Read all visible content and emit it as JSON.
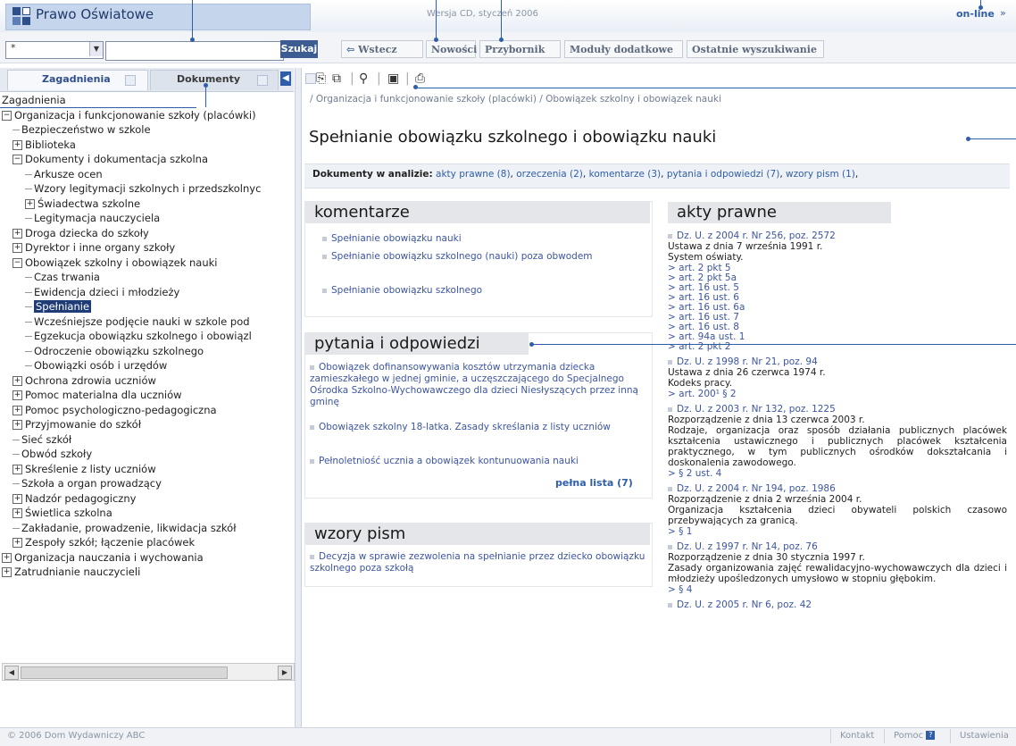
{
  "app": {
    "title": "Prawo Oświatowe",
    "version": "Wersja CD, styczeń 2006",
    "online": "on-line",
    "online_arrow": "»"
  },
  "toolbar": {
    "combo_value": "*",
    "search_placeholder": "",
    "search_label": "Szukaj",
    "back_label": "Wstecz",
    "buttons": [
      "Nowości",
      "Przybornik",
      "Moduły dodatkowe",
      "Ostatnie wyszukiwanie"
    ]
  },
  "left": {
    "tabs": [
      "Zagadnienia",
      "Dokumenty"
    ],
    "tree": [
      {
        "label": "Zagadnienia",
        "level": 0,
        "toggle": ""
      },
      {
        "label": "Organizacja i funkcjonowanie szkoły (placówki)",
        "level": 0,
        "toggle": "-"
      },
      {
        "label": "Bezpieczeństwo w szkole",
        "level": 1,
        "toggle": ""
      },
      {
        "label": "Biblioteka",
        "level": 1,
        "toggle": "+"
      },
      {
        "label": "Dokumenty i dokumentacja szkolna",
        "level": 1,
        "toggle": "-"
      },
      {
        "label": "Arkusze ocen",
        "level": 2,
        "toggle": ""
      },
      {
        "label": "Wzory legitymacji szkolnych i przedszkolnyc",
        "level": 2,
        "toggle": ""
      },
      {
        "label": "Świadectwa szkolne",
        "level": 2,
        "toggle": "+"
      },
      {
        "label": "Legitymacja nauczyciela",
        "level": 2,
        "toggle": ""
      },
      {
        "label": "Droga dziecka do szkoły",
        "level": 1,
        "toggle": "+"
      },
      {
        "label": "Dyrektor i inne organy szkoły",
        "level": 1,
        "toggle": "+"
      },
      {
        "label": "Obowiązek szkolny i obowiązek nauki",
        "level": 1,
        "toggle": "-"
      },
      {
        "label": "Czas trwania",
        "level": 2,
        "toggle": ""
      },
      {
        "label": "Ewidencja dzieci i młodzieży",
        "level": 2,
        "toggle": ""
      },
      {
        "label": "Spełnianie",
        "level": 2,
        "toggle": "",
        "selected": true
      },
      {
        "label": "Wcześniejsze podjęcie nauki w szkole pod",
        "level": 2,
        "toggle": ""
      },
      {
        "label": "Egzekucja obowiązku szkolnego i obowiązl",
        "level": 2,
        "toggle": ""
      },
      {
        "label": "Odroczenie obowiązku szkolnego",
        "level": 2,
        "toggle": ""
      },
      {
        "label": "Obowiązki osób i urzędów",
        "level": 2,
        "toggle": ""
      },
      {
        "label": "Ochrona zdrowia uczniów",
        "level": 1,
        "toggle": "+"
      },
      {
        "label": "Pomoc materialna dla uczniów",
        "level": 1,
        "toggle": "+"
      },
      {
        "label": "Pomoc psychologiczno-pedagogiczna",
        "level": 1,
        "toggle": "+"
      },
      {
        "label": "Przyjmowanie do szkół",
        "level": 1,
        "toggle": "+"
      },
      {
        "label": "Sieć szkół",
        "level": 1,
        "toggle": ""
      },
      {
        "label": "Obwód szkoły",
        "level": 1,
        "toggle": ""
      },
      {
        "label": "Skreślenie z listy uczniów",
        "level": 1,
        "toggle": "+"
      },
      {
        "label": "Szkoła a organ prowadzący",
        "level": 1,
        "toggle": ""
      },
      {
        "label": "Nadzór pedagogiczny",
        "level": 1,
        "toggle": "+"
      },
      {
        "label": "Świetlica szkolna",
        "level": 1,
        "toggle": "+"
      },
      {
        "label": "Zakładanie, prowadzenie, likwidacja szkół",
        "level": 1,
        "toggle": ""
      },
      {
        "label": "Zespoły szkół; łączenie placówek",
        "level": 1,
        "toggle": "+"
      },
      {
        "label": "Organizacja nauczania i wychowania",
        "level": 0,
        "toggle": "+"
      },
      {
        "label": "Zatrudnianie nauczycieli",
        "level": 0,
        "toggle": "+"
      }
    ]
  },
  "content": {
    "breadcrumb": "/ Organizacja i funkcjonowanie szkoły (placówki) / Obowiązek szkolny i obowiązek nauki",
    "title": "Spełnianie obowiązku szkolnego i obowiązku nauki",
    "analysis_label": "Dokumenty w analizie:",
    "analysis_links": [
      "akty prawne (8)",
      "orzeczenia (2)",
      "komentarze (3)",
      "pytania i odpowiedzi (7)",
      "wzory pism (1)"
    ],
    "komentarze": {
      "heading": "komentarze",
      "items": [
        "Spełnianie obowiązku nauki",
        "Spełnianie obowiązku szkolnego (nauki) poza obwodem",
        "Spełnianie obowiązku szkolnego"
      ]
    },
    "pytania": {
      "heading": "pytania i odpowiedzi",
      "items": [
        "Obowiązek dofinansowywania kosztów utrzymania dziecka zamieszkałego w jednej gminie, a uczęszczającego do Specjalnego Ośrodka Szkolno-Wychowawczego dla dzieci Niesłyszących przez inną gminę",
        "Obowiązek szkolny 18-latka. Zasady skreślania z listy uczniów",
        "Pełnoletniość ucznia a obowiązek kontunuowania nauki"
      ],
      "full_list": "pełna lista (7)"
    },
    "wzory": {
      "heading": "wzory pism",
      "items": [
        "Decyzja w sprawie zezwolenia na spełnianie przez dziecko obowiązku szkolnego poza szkołą"
      ]
    },
    "akty": {
      "heading": "akty prawne",
      "entries": [
        {
          "ref": "Dz. U. z 2004 r. Nr 256, poz. 2572",
          "lines": [
            "Ustawa z dnia 7 września 1991 r.",
            "System oświaty."
          ],
          "links": [
            "> art. 2 pkt 5",
            "> art. 2 pkt 5a",
            "> art. 16 ust. 5",
            "> art. 16 ust. 6",
            "> art. 16 ust. 6a",
            "> art. 16 ust. 7",
            "> art. 16 ust. 8",
            "> art. 94a ust. 1",
            "> art. 2 pkt 2"
          ]
        },
        {
          "ref": "Dz. U. z 1998 r. Nr 21, poz. 94",
          "lines": [
            "Ustawa z dnia 26 czerwca 1974 r.",
            "Kodeks pracy."
          ],
          "links": [
            "> art. 200¹ § 2"
          ]
        },
        {
          "ref": "Dz. U. z 2003 r. Nr 132, poz. 1225",
          "lines": [
            "Rozporządzenie z dnia 13 czerwca 2003 r.",
            "Rodzaje, organizacja oraz sposób działania publicznych placówek kształcenia ustawicznego i publicznych placówek kształcenia praktycznego, w tym publicznych ośrodków dokształcania i doskonalenia zawodowego."
          ],
          "links": [
            "> § 2 ust. 4"
          ]
        },
        {
          "ref": "Dz. U. z 2004 r. Nr 194, poz. 1986",
          "lines": [
            "Rozporządzenie z dnia 2 września 2004 r.",
            "Organizacja kształcenia dzieci obywateli polskich czasowo przebywających za granicą."
          ],
          "links": [
            "> § 1"
          ]
        },
        {
          "ref": "Dz. U. z 1997 r. Nr 14, poz. 76",
          "lines": [
            "Rozporządzenie z dnia 30 stycznia 1997 r.",
            "Zasady organizowania zajęć rewalidacyjno-wychowawczych dla dzieci i młodzieży upośledzonych umysłowo w stopniu głębokim."
          ],
          "links": [
            "> § 4"
          ]
        },
        {
          "ref": "Dz. U. z 2005 r. Nr 6, poz. 42",
          "lines": [],
          "links": []
        }
      ]
    }
  },
  "statusbar": {
    "copyright": "© 2006 Dom Wydawniczy ABC",
    "kontakt": "Kontakt",
    "pomoc": "Pomoc",
    "ustawienia": "Ustawienia"
  },
  "colors": {
    "accent": "#2f5ea8",
    "header_dark": "#22396b",
    "selected_bg": "#1f3c77"
  }
}
